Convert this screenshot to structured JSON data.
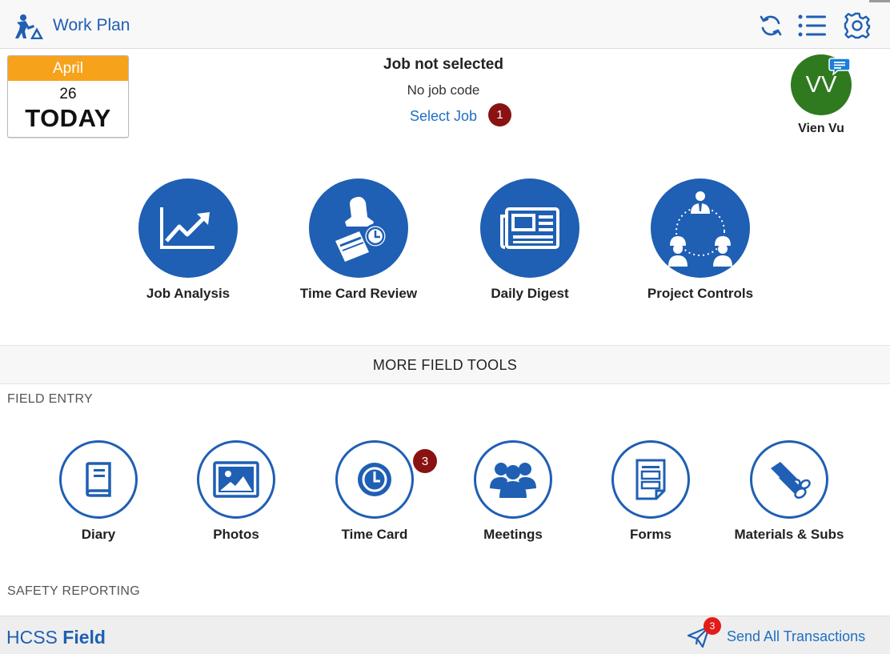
{
  "header": {
    "title": "Work Plan",
    "home_icon": "worker-icon",
    "buttons": [
      {
        "name": "sync",
        "icon": "refresh-icon"
      },
      {
        "name": "menu",
        "icon": "list-icon"
      },
      {
        "name": "settings",
        "icon": "gear-icon"
      }
    ]
  },
  "calendar": {
    "month": "April",
    "day": "26",
    "label": "TODAY"
  },
  "job": {
    "title": "Job not selected",
    "code": "No job code",
    "select_label": "Select Job",
    "badge_count": "1"
  },
  "user": {
    "initials": "VV",
    "name": "Vien Vu",
    "chat_icon": "chat-bubble-icon"
  },
  "main_tiles": [
    {
      "label": "Job Analysis",
      "icon": "chart-up-icon"
    },
    {
      "label": "Time Card Review",
      "icon": "stamp-clock-icon"
    },
    {
      "label": "Daily Digest",
      "icon": "newspaper-icon"
    },
    {
      "label": "Project Controls",
      "icon": "team-network-icon"
    }
  ],
  "more_tools": {
    "header": "MORE FIELD TOOLS",
    "field_entry_label": "FIELD ENTRY",
    "safety_label": "SAFETY REPORTING",
    "items": [
      {
        "label": "Diary",
        "icon": "book-icon"
      },
      {
        "label": "Photos",
        "icon": "image-icon"
      },
      {
        "label": "Time Card",
        "icon": "clock-icon",
        "badge": "3"
      },
      {
        "label": "Meetings",
        "icon": "people-icon"
      },
      {
        "label": "Forms",
        "icon": "form-icon"
      },
      {
        "label": "Materials & Subs",
        "icon": "pipes-icon"
      }
    ]
  },
  "footer": {
    "brand_light": "HCSS",
    "brand_bold": "Field",
    "send_label": "Send All Transactions",
    "send_badge": "3",
    "send_icon": "paper-plane-icon"
  },
  "colors": {
    "primary": "#1f5fb4",
    "accent_orange": "#f7a21b",
    "avatar_green": "#2f7a1f",
    "badge_dark_red": "#8b1212",
    "badge_red": "#e41b1b"
  }
}
